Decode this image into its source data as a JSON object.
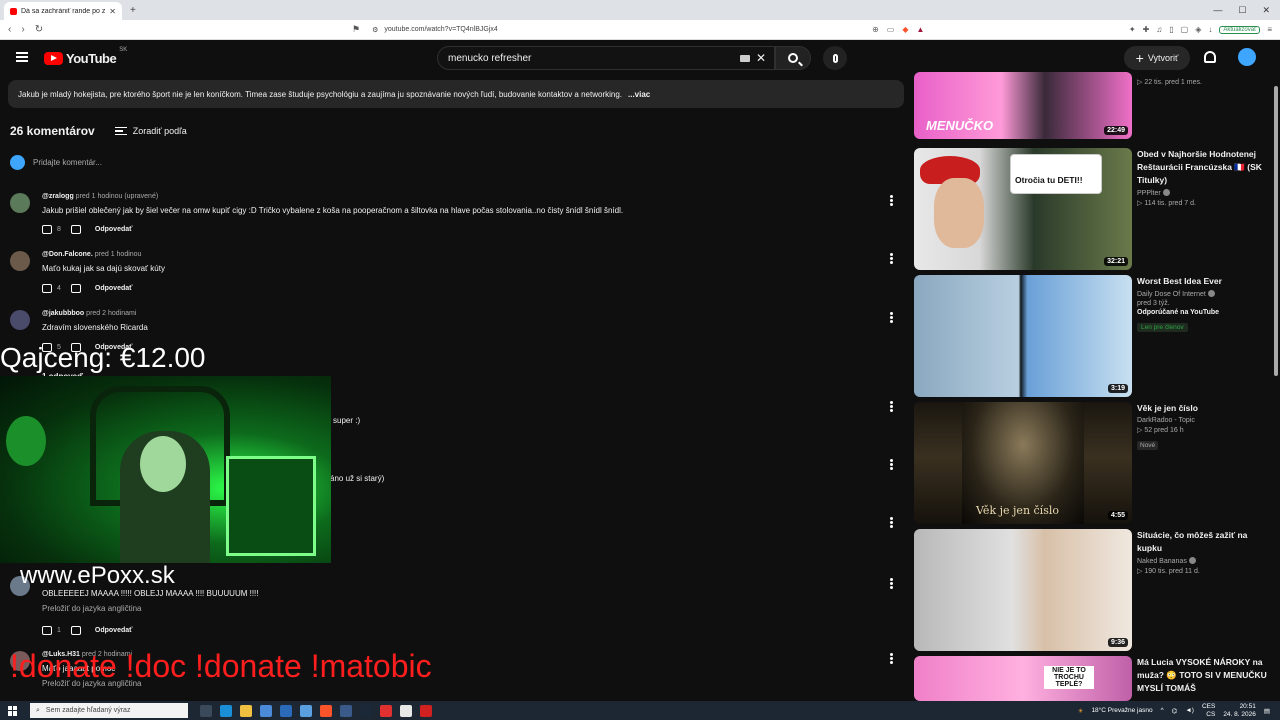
{
  "browser": {
    "tab_title": "Dá sa zachrániť rande po zlom začiatku?",
    "url": "youtube.com/watch?v=TQ4nlBJGjx4",
    "update_label": "Aktualizovať"
  },
  "header": {
    "logo_text": "YouTube",
    "country_code": "SK",
    "search_value": "menucko refresher",
    "create_label": "Vytvoriť"
  },
  "description": {
    "text": "Jakub je mladý hokejista, pre ktorého šport nie je len koníčkom. Timea zase študuje psychológiu a zaujíma ju spoznávanie nových ľudí, budovanie kontaktov a networking.",
    "more_label": "...viac"
  },
  "comments_section": {
    "count_label": "26 komentárov",
    "sort_label": "Zoradiť podľa",
    "add_placeholder": "Pridajte komentár...",
    "reply_label": "Odpovedať"
  },
  "comments": [
    {
      "author": "@zralogg",
      "time": "pred 1 hodinou (upravené)",
      "text": "Jakub prišiel oblečený jak by šiel večer na omw kupiť cigy :D Tričko vybalene z koša na pooperačnom a šiltovka na hlave počas stolovania..no čisty šnídl šnídl šnídl.",
      "likes": "8"
    },
    {
      "author": "@Don.Falcone.",
      "time": "pred 1 hodinou",
      "text": "Maťo kukaj jak sa dajú skovať kúty",
      "likes": "4"
    },
    {
      "author": "@jakubbboo",
      "time": "pred 2 hodinami",
      "text": "Zdravím slovenského Ricarda",
      "likes": "5"
    },
    {
      "author": "",
      "time": "",
      "text": "OBLEEEEEJ MAAAA !!!!! OBLEJJ MAAAA !!!! BUUUUUM !!!!",
      "translate": "Preložiť do jazyka angličtina",
      "likes": "1"
    },
    {
      "author": "@Luks.H31",
      "time": "pred 2 hodinami",
      "text": "Maťo jaaaaat pomoc",
      "translate": "Preložiť do jazyka angličtina",
      "likes": ""
    }
  ],
  "partial_texts": {
    "reply_count": "1 odpoveď",
    "super": "super :)",
    "star": "áno už si starý)"
  },
  "overlays": {
    "donation": "Qajceng: €12.00",
    "website": "www.ePoxx.sk",
    "commands": "!donate !doc !donate !matobic"
  },
  "sidebar": [
    {
      "title": "",
      "channel": "",
      "stats": "▷ 22 tis.   pred 1 mes.",
      "duration": "22:49",
      "thumb_text": "MENUČKO"
    },
    {
      "title": "Obed v Najhoršie Hodnotenej Reštaurácii Francúzska 🇫🇷 (SK Titulky)",
      "channel": "PPPlter",
      "stats": "▷ 114 tis.   pred 7 d.",
      "duration": "32:21",
      "thumb_text": "Otročia tu DETI!!"
    },
    {
      "title": "Worst Best Idea Ever",
      "channel": "Daily Dose Of Internet",
      "stats": "pred 3 týž.",
      "recommended": "Odporúčané na YouTube",
      "member": "Len pre členov",
      "duration": "3:19"
    },
    {
      "title": "Věk je jen číslo",
      "channel": "DarkRadoo - Topic",
      "stats": "▷ 52   pred 16 h",
      "badge": "Nové",
      "duration": "4:55",
      "thumb_text": "Věk je jen číslo"
    },
    {
      "title": "Situácie, čo môžeš zažiť na kupku",
      "channel": "Naked Bananas",
      "stats": "▷ 190 tis.   pred 11 d.",
      "duration": "9:36"
    },
    {
      "title": "Má Lucia VYSOKÉ NÁROKY na muža? 😳 TOTO SI V MENUČKU MYSLÍ TOMÁŠ",
      "channel": "",
      "stats": "",
      "duration": "",
      "thumb_text": "NIE JE TO TROCHU TEPLÉ?"
    }
  ],
  "taskbar": {
    "search_placeholder": "Sem zadajte hľadaný výraz",
    "weather": "18°C  Prevažne jasno",
    "lang": "CES",
    "lang2": "CS",
    "time": "20:51",
    "date": "24. 8. 2026"
  }
}
